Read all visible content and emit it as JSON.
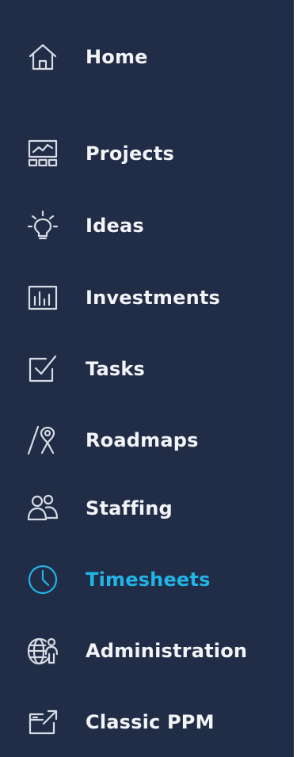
{
  "nav": {
    "items": [
      {
        "label": "Home",
        "icon": "home-icon"
      },
      {
        "label": "Projects",
        "icon": "projects-icon"
      },
      {
        "label": "Ideas",
        "icon": "lightbulb-icon"
      },
      {
        "label": "Investments",
        "icon": "bar-chart-icon"
      },
      {
        "label": "Tasks",
        "icon": "checkbox-icon"
      },
      {
        "label": "Roadmaps",
        "icon": "roadmap-pin-icon"
      },
      {
        "label": "Staffing",
        "icon": "people-icon"
      },
      {
        "label": "Timesheets",
        "icon": "clock-icon"
      },
      {
        "label": "Administration",
        "icon": "globe-person-icon"
      },
      {
        "label": "Classic PPM",
        "icon": "external-window-icon"
      }
    ],
    "active": "Timesheets"
  },
  "colors": {
    "background": "#212d47",
    "text": "#f2f4f8",
    "active": "#20b5e6",
    "icon": "#d7dbe4"
  }
}
